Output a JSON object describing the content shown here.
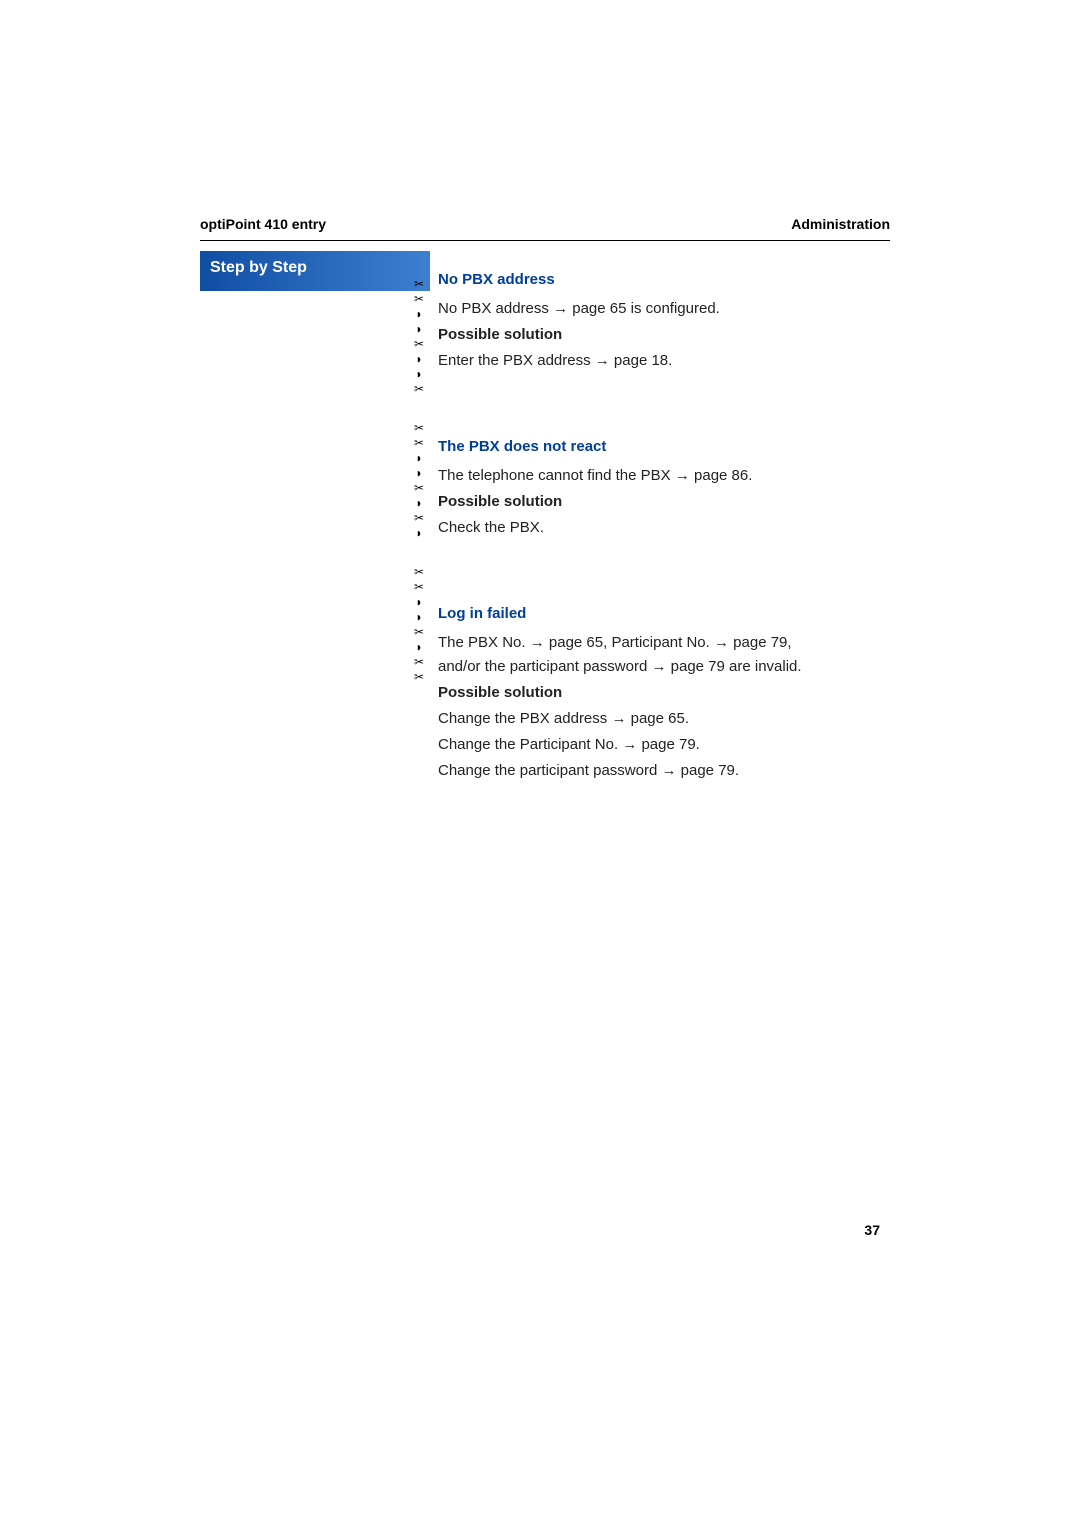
{
  "header": {
    "left": "optiPoint 410 entry",
    "right": "Administration"
  },
  "sidebar": {
    "title": "Step by Step"
  },
  "sections": {
    "noPbx": {
      "title": "No PBX address",
      "line1a": "No PBX address ",
      "line1b": " page 65 is configured.",
      "solution_label": "Possible solution",
      "sol1a": "Enter the PBX address ",
      "sol1b": " page 18."
    },
    "noReact": {
      "title": "The PBX does not react",
      "line1a": "The telephone cannot find the PBX ",
      "line1b": " page 86.",
      "solution_label": "Possible solution",
      "sol1": "Check the PBX."
    },
    "login": {
      "title": "Log in failed",
      "line1a": "The PBX No. ",
      "line1b": " page 65, Participant No. ",
      "line1c": " page 79,",
      "line2a": "and/or the participant password ",
      "line2b": " page 79 are invalid.",
      "solution_label": "Possible solution",
      "sol1a": "Change the PBX address ",
      "sol1b": " page 65.",
      "sol2a": "Change the Participant No. ",
      "sol2b": " page 79.",
      "sol3a": "Change the participant password ",
      "sol3b": " page 79."
    }
  },
  "glyphs": {
    "arrow": "→",
    "cut": "✂",
    "bullet": "◗"
  },
  "pageNumber": "37"
}
